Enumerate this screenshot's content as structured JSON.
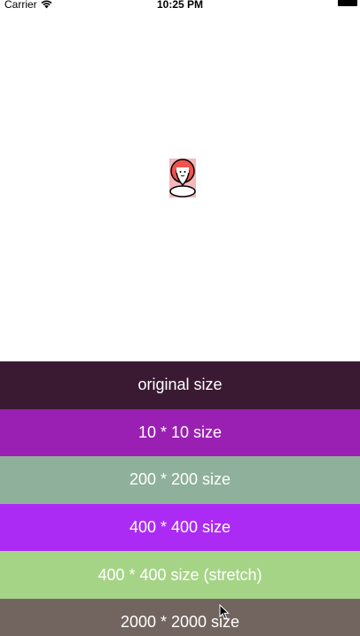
{
  "status_bar": {
    "carrier": "Carrier",
    "time": "10:25 PM",
    "wifi_icon": "wifi-icon",
    "battery_icon": "battery-icon"
  },
  "preview": {
    "icon": "avatar-pin-image"
  },
  "buttons": [
    {
      "label": "original size",
      "color": "#3a1a33"
    },
    {
      "label": "10 * 10 size",
      "color": "#9a1fb3"
    },
    {
      "label": "200 * 200 size",
      "color": "#8fb09b"
    },
    {
      "label": "400 * 400 size",
      "color": "#ac2bf4"
    },
    {
      "label": "400 * 400 size (stretch)",
      "color": "#a6d487"
    },
    {
      "label": "2000 * 2000 size",
      "color": "#726560"
    }
  ]
}
